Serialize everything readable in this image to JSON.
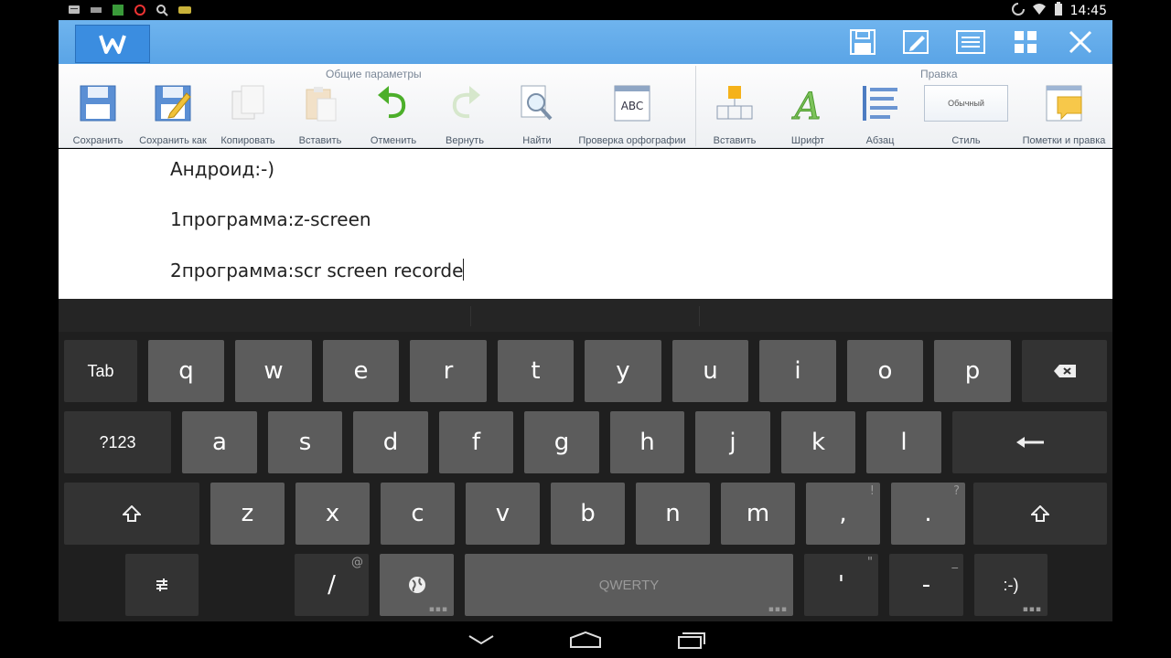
{
  "status": {
    "time": "14:45"
  },
  "ribbon": {
    "group_general": "Общие параметры",
    "group_edit": "Правка",
    "buttons": [
      {
        "label": "Сохранить"
      },
      {
        "label": "Сохранить как"
      },
      {
        "label": "Копировать"
      },
      {
        "label": "Вставить"
      },
      {
        "label": "Отменить"
      },
      {
        "label": "Вернуть"
      },
      {
        "label": "Найти"
      },
      {
        "label": "Проверка орфографии",
        "icon_text": "ABC"
      },
      {
        "label": "Вставить"
      },
      {
        "label": "Шрифт",
        "icon_text": "A"
      },
      {
        "label": "Абзац"
      },
      {
        "label": "Стиль",
        "preview": "Обычный"
      },
      {
        "label": "Пометки и правка"
      }
    ]
  },
  "document": {
    "lines": [
      "Андроид:-)",
      "1программа:z-screen",
      "2программа:scr screen recorde"
    ]
  },
  "keyboard": {
    "row1": {
      "fn": "Tab",
      "keys": [
        "q",
        "w",
        "e",
        "r",
        "t",
        "y",
        "u",
        "i",
        "o",
        "p"
      ]
    },
    "row2": {
      "fn": "?123",
      "keys": [
        "a",
        "s",
        "d",
        "f",
        "g",
        "h",
        "j",
        "k",
        "l"
      ]
    },
    "row3": {
      "keys": [
        "z",
        "x",
        "c",
        "v",
        "b",
        "n",
        "m",
        ",",
        "."
      ],
      "hints": {
        "comma": "!",
        "period": "?"
      }
    },
    "row4": {
      "slash": "/",
      "slash_hint": "@",
      "space": "QWERTY",
      "apostrophe": "'",
      "apostrophe_hint": "\"",
      "dash": "-",
      "dash_hint": "_",
      "smiley": ":-)"
    }
  },
  "colors": {
    "titlebar": "#5aa4e6",
    "accent_green": "#4caf2a",
    "accent_orange": "#f5a623"
  },
  "icons": {
    "titlebar": [
      "save-icon",
      "edit-icon",
      "list-icon",
      "grid-icon",
      "close-icon"
    ],
    "nav": [
      "back-icon",
      "home-icon",
      "recents-icon"
    ]
  }
}
